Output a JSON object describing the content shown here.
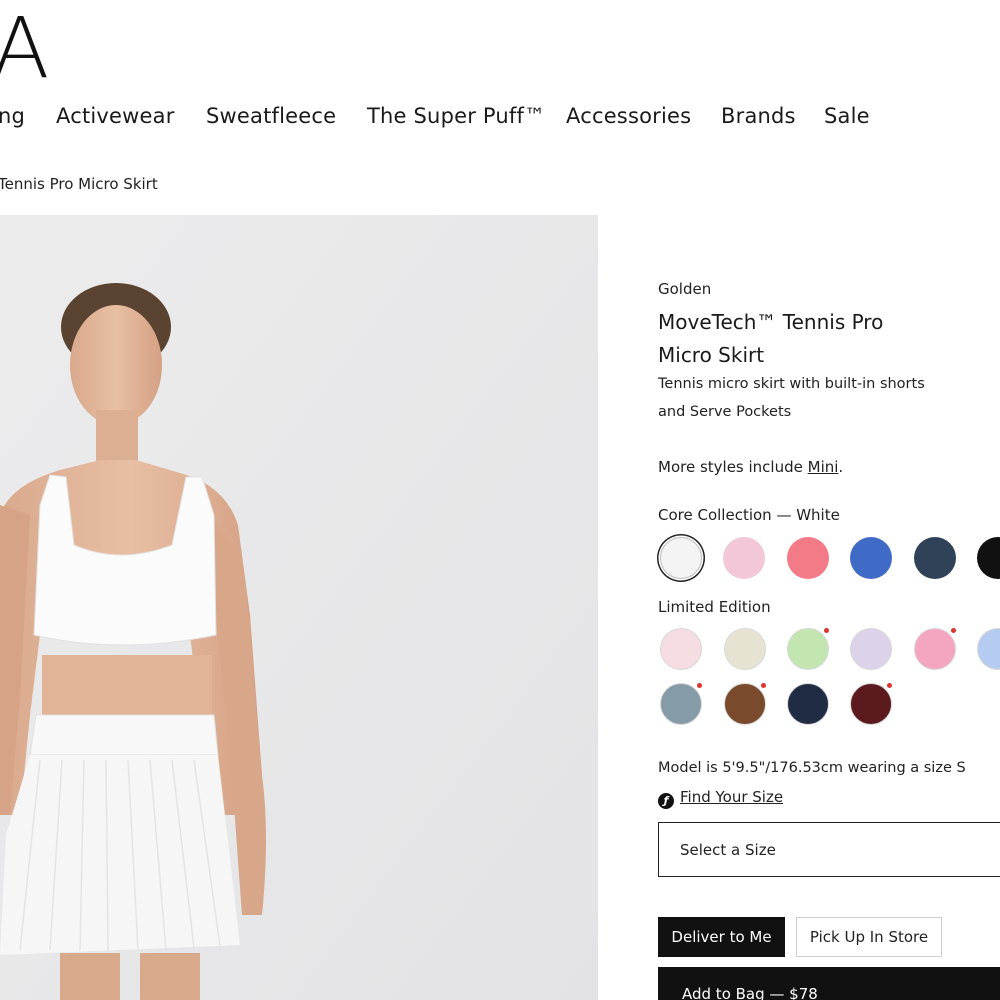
{
  "logo": "A",
  "nav": {
    "items": [
      {
        "label": "ng"
      },
      {
        "label": "Activewear"
      },
      {
        "label": "Sweatfleece"
      },
      {
        "label": "The Super Puff™"
      },
      {
        "label": "Accessories"
      },
      {
        "label": "Brands"
      },
      {
        "label": "Sale"
      }
    ]
  },
  "breadcrumb": "Tennis Pro Micro Skirt",
  "product": {
    "brand": "Golden",
    "title_line1": "MoveTech™ Tennis Pro",
    "title_line2": "Micro Skirt",
    "desc_line1": "Tennis micro skirt with built-in shorts",
    "desc_line2": "and Serve Pockets",
    "more_styles_prefix": "More styles include ",
    "more_styles_link": "Mini",
    "more_styles_suffix": ".",
    "core_label": "Core Collection — White",
    "limited_label": "Limited Edition",
    "core_colors": [
      "#f4f4f4",
      "#f2c7d8",
      "#f27b87",
      "#3f6bc6",
      "#2f4257",
      "#111111"
    ],
    "limited_colors": [
      {
        "color": "#f6dde1",
        "new": false
      },
      {
        "color": "#e7e3d3",
        "new": false
      },
      {
        "color": "#c3e6b0",
        "new": true
      },
      {
        "color": "#dcd3ea",
        "new": false
      },
      {
        "color": "#f4a6c1",
        "new": true
      },
      {
        "color": "#b5cbf2",
        "new": false
      },
      {
        "color": "#869ba8",
        "new": true
      },
      {
        "color": "#7a4a2c",
        "new": true
      },
      {
        "color": "#1f2c44",
        "new": false
      },
      {
        "color": "#5a1a1e",
        "new": true
      }
    ],
    "model_info": "Model is 5'9.5\"/176.53cm wearing a size S",
    "find_size": "Find Your Size",
    "find_size_icon": "measure-icon",
    "size_select_placeholder": "Select a Size",
    "deliver_label": "Deliver to Me",
    "pickup_label": "Pick Up In Store",
    "add_to_bag": "Add to Bag — $78"
  }
}
